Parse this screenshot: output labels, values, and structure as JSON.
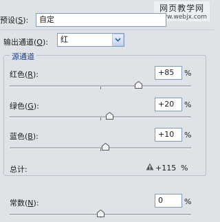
{
  "watermark": {
    "line1": "网页教学网",
    "line2": "www.webjx.com"
  },
  "preset": {
    "label_pre": "预设(",
    "key": "S",
    "label_post": "):",
    "value": "自定"
  },
  "output_channel": {
    "label_pre": "输出通道(",
    "key": "O",
    "label_post": "):",
    "value": "红"
  },
  "source_group": {
    "title": "源通道",
    "sliders": [
      {
        "label_pre": "红色(",
        "key": "R",
        "label_post": "):",
        "value": "+85",
        "unit": "%",
        "level": 85
      },
      {
        "label_pre": "绿色(",
        "key": "G",
        "label_post": "):",
        "value": "+20",
        "unit": "%",
        "level": 20
      },
      {
        "label_pre": "蓝色(",
        "key": "B",
        "label_post": "):",
        "value": "+10",
        "unit": "%",
        "level": 10
      }
    ],
    "total": {
      "label": "总计:",
      "value": "+115",
      "unit": "%"
    }
  },
  "constant": {
    "label_pre": "常数(",
    "key": "N",
    "label_post": "):",
    "value": "0",
    "unit": "%",
    "level": 0
  },
  "colors": {
    "accent": "#1c3d8c",
    "border": "#7f9db9",
    "background": "#dfe3e8"
  },
  "icons": {
    "dropdown": "chevron-down-icon",
    "warning": "warning-icon",
    "thumb": "slider-thumb-icon"
  }
}
